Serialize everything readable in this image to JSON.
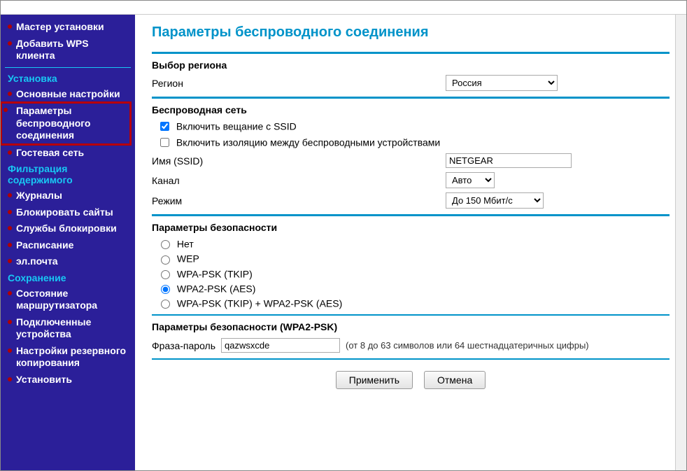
{
  "sidebar": {
    "items": [
      {
        "label": "Мастер установки",
        "type": "bullet"
      },
      {
        "label": "Добавить WPS клиента",
        "type": "bullet"
      },
      {
        "label": "Установка",
        "type": "section"
      },
      {
        "label": "Основные настройки",
        "type": "bullet"
      },
      {
        "label": "Параметры беспроводного соединения",
        "type": "bullet",
        "selected": true
      },
      {
        "label": "Гостевая сеть",
        "type": "bullet"
      },
      {
        "label": "Фильтрация содержимого",
        "type": "section"
      },
      {
        "label": "Журналы",
        "type": "bullet"
      },
      {
        "label": "Блокировать сайты",
        "type": "bullet"
      },
      {
        "label": "Службы блокировки",
        "type": "bullet"
      },
      {
        "label": "Расписание",
        "type": "bullet"
      },
      {
        "label": "эл.почта",
        "type": "bullet"
      },
      {
        "label": "Сохранение",
        "type": "section"
      },
      {
        "label": "Состояние маршрутизатора",
        "type": "bullet"
      },
      {
        "label": "Подключенные устройства",
        "type": "bullet"
      },
      {
        "label": "Настройки резервного копирования",
        "type": "bullet"
      },
      {
        "label": "Установить",
        "type": "bullet"
      }
    ]
  },
  "page": {
    "title": "Параметры беспроводного соединения"
  },
  "region": {
    "section_label": "Выбор региона",
    "label": "Регион",
    "value": "Россия"
  },
  "wireless": {
    "section_label": "Беспроводная сеть",
    "broadcast_ssid": {
      "label": "Включить вещание с SSID",
      "checked": true
    },
    "isolation": {
      "label": "Включить изоляцию между беспроводными устройствами",
      "checked": false
    },
    "ssid_label": "Имя (SSID)",
    "ssid_value": "NETGEAR",
    "channel_label": "Канал",
    "channel_value": "Авто",
    "mode_label": "Режим",
    "mode_value": "До 150 Мбит/с"
  },
  "security": {
    "section_label": "Параметры безопасности",
    "options": [
      {
        "label": "Нет"
      },
      {
        "label": "WEP"
      },
      {
        "label": "WPA-PSK (TKIP)"
      },
      {
        "label": "WPA2-PSK (AES)",
        "selected": true
      },
      {
        "label": "WPA-PSK (TKIP) + WPA2-PSK (AES)"
      }
    ]
  },
  "passphrase": {
    "section_label": "Параметры безопасности (WPA2-PSK)",
    "label": "Фраза-пароль",
    "value": "qazwsxcde",
    "hint": "(от 8 до 63 символов или 64 шестнадцатеричных цифры)"
  },
  "buttons": {
    "apply": "Применить",
    "cancel": "Отмена"
  }
}
